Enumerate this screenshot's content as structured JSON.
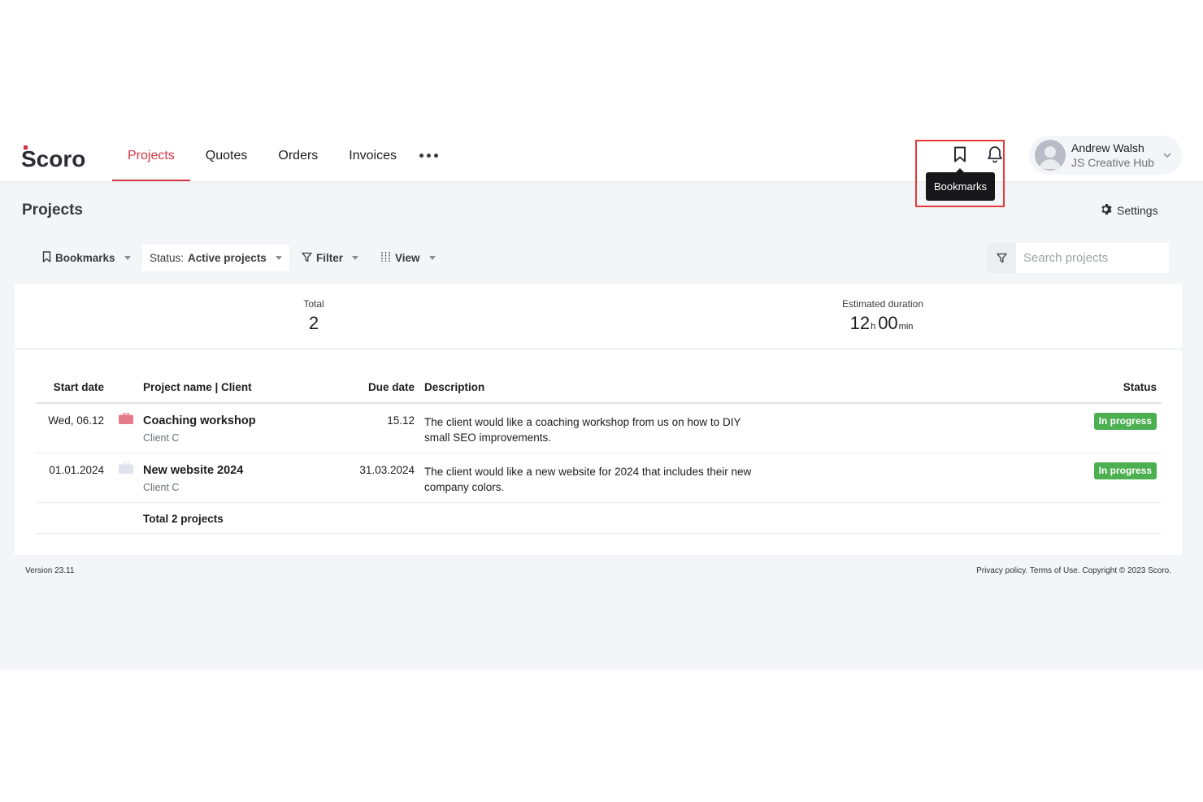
{
  "app": {
    "logo_text": "Scoro",
    "brand_color": "#d63545"
  },
  "nav": {
    "items": [
      {
        "label": "Projects",
        "active": true
      },
      {
        "label": "Quotes",
        "active": false
      },
      {
        "label": "Orders",
        "active": false
      },
      {
        "label": "Invoices",
        "active": false
      }
    ],
    "more_icon": "more-horizontal-icon"
  },
  "header_icons": {
    "bookmarks_icon": "bookmark-icon",
    "notifications_icon": "bell-icon",
    "tooltip": "Bookmarks"
  },
  "user": {
    "name": "Andrew Walsh",
    "company": "JS Creative Hub"
  },
  "page": {
    "title": "Projects",
    "settings_label": "Settings"
  },
  "toolbar": {
    "bookmarks_label": "Bookmarks",
    "status_prefix": "Status:",
    "status_value": "Active projects",
    "filter_label": "Filter",
    "view_label": "View",
    "search_placeholder": "Search projects"
  },
  "summary": {
    "total_label": "Total",
    "total_value": "2",
    "duration_label": "Estimated duration",
    "duration_hours": "12",
    "duration_hours_unit": "h",
    "duration_minutes": "00",
    "duration_minutes_unit": "min"
  },
  "table": {
    "headers": {
      "start_date": "Start date",
      "project_client": "Project name | Client",
      "due_date": "Due date",
      "description": "Description",
      "status": "Status"
    },
    "rows": [
      {
        "start_date": "Wed, 06.12",
        "icon_color": "#e57a8a",
        "name": "Coaching workshop",
        "client": "Client C",
        "due_date": "15.12",
        "description": "The client would like a coaching workshop from us on how to DIY small SEO improvements.",
        "status": "In progress"
      },
      {
        "start_date": "01.01.2024",
        "icon_color": "#dfe3ec",
        "name": "New website 2024",
        "client": "Client C",
        "due_date": "31.03.2024",
        "description": "The client would like a new website for 2024 that includes their new company colors.",
        "status": "In progress"
      }
    ],
    "total_label": "Total 2 projects"
  },
  "footer": {
    "version": "Version 23.11",
    "legal": "Privacy policy. Terms of Use. Copyright © 2023 Scoro."
  },
  "colors": {
    "status_in_progress": "#4caf50",
    "highlight": "#e53935"
  }
}
